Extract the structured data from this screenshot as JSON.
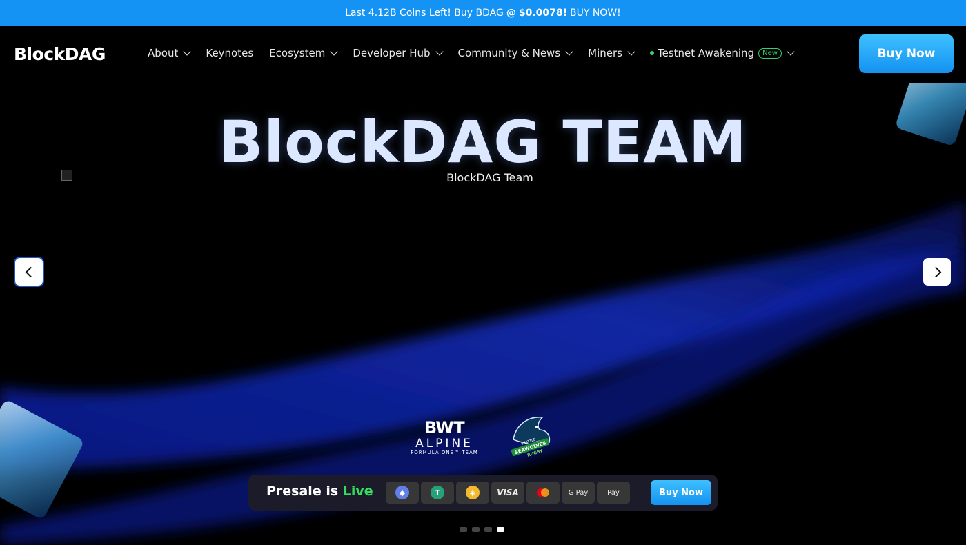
{
  "announcement": {
    "text_before": "Last 4.12B Coins Left! Buy BDAG",
    "at": "@",
    "price": "$0.0078!",
    "text_after": "BUY NOW!"
  },
  "header": {
    "logo": "BlockDAG",
    "nav": [
      {
        "label": "About",
        "dropdown": true
      },
      {
        "label": "Keynotes",
        "dropdown": false
      },
      {
        "label": "Ecosystem",
        "dropdown": true
      },
      {
        "label": "Developer Hub",
        "dropdown": true
      },
      {
        "label": "Community & News",
        "dropdown": true
      },
      {
        "label": "Miners",
        "dropdown": true
      },
      {
        "label": "Testnet Awakening",
        "badge": "New",
        "dropdown": true,
        "status_dot_color": "#2fd36b"
      }
    ],
    "buy_button": "Buy Now"
  },
  "hero": {
    "title": "BlockDAG TEAM",
    "image_alt": "BlockDAG Team",
    "prev_icon": "chevron-left-icon",
    "next_icon": "chevron-right-icon"
  },
  "partners": [
    {
      "line1": "BWT",
      "line2": "ALPINE",
      "line3": "FORMULA ONE™ TEAM"
    },
    {
      "line1": "SEATTLE",
      "line2": "SEAWOLVES",
      "line3": "RUGBY"
    }
  ],
  "presale": {
    "label_prefix": "Presale is",
    "label_status": "Live",
    "payment_methods": [
      {
        "name": "ethereum",
        "icon": "ethereum-icon",
        "text": "◆",
        "color": "#627eea"
      },
      {
        "name": "tether",
        "icon": "tether-icon",
        "text": "T",
        "color": "#26a17b"
      },
      {
        "name": "bnb",
        "icon": "bnb-icon",
        "text": "◈",
        "color": "#f3ba2f"
      },
      {
        "name": "visa",
        "icon": "visa-icon",
        "text": "VISA"
      },
      {
        "name": "mastercard",
        "icon": "mastercard-icon",
        "text": ""
      },
      {
        "name": "google-pay",
        "icon": "google-pay-icon",
        "text": "G Pay"
      },
      {
        "name": "apple-pay",
        "icon": "apple-pay-icon",
        "text": " Pay"
      }
    ],
    "buy_button": "Buy Now"
  },
  "carousel": {
    "slide_count": 4,
    "active_index": 3
  },
  "colors": {
    "accent": "#1593f5",
    "live": "#32e05f",
    "background": "#000000"
  }
}
